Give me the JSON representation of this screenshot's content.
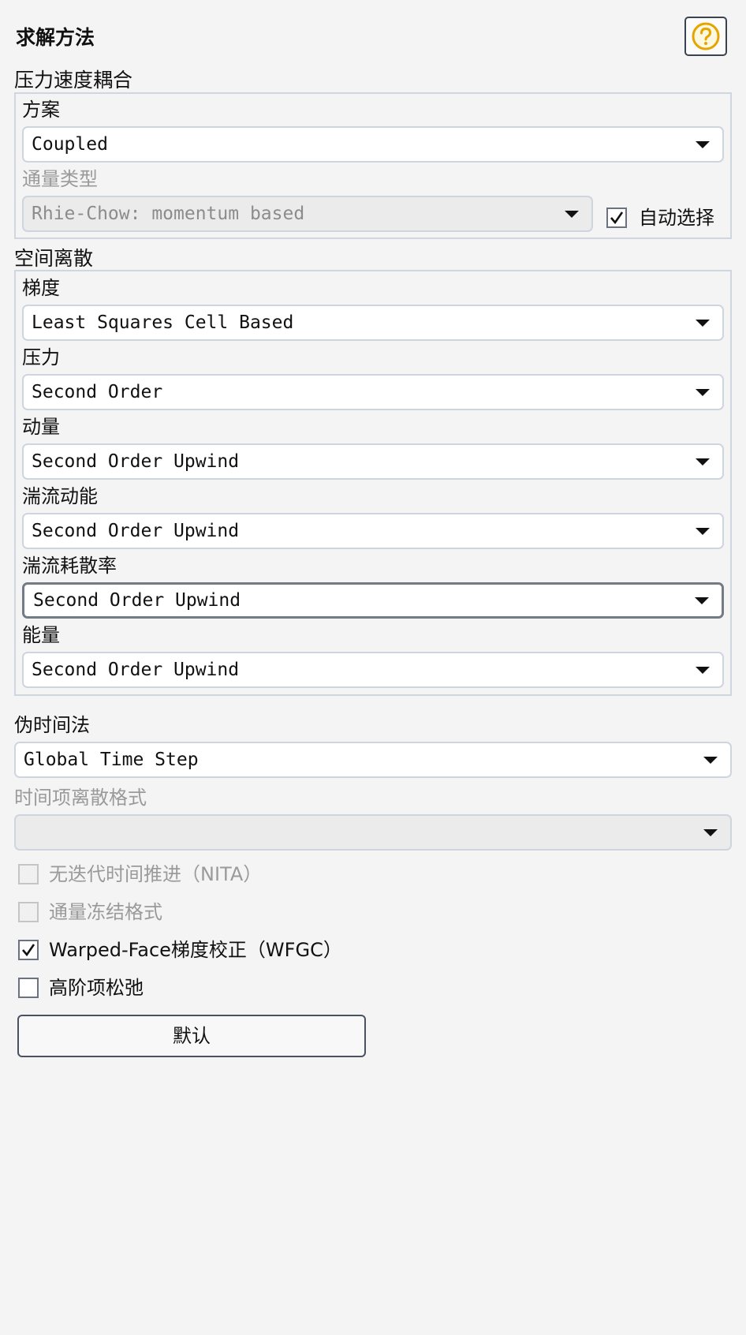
{
  "panel": {
    "title": "求解方法",
    "help_icon": "question-mark-circle-icon"
  },
  "pressure_velocity": {
    "section_title": "压力速度耦合",
    "scheme_label": "方案",
    "scheme_value": "Coupled",
    "flux_type_label": "通量类型",
    "flux_type_value": "Rhie-Chow: momentum based",
    "auto_select_label": "自动选择",
    "auto_select_checked": true
  },
  "spatial": {
    "section_title": "空间离散",
    "gradient_label": "梯度",
    "gradient_value": "Least Squares Cell Based",
    "pressure_label": "压力",
    "pressure_value": "Second Order",
    "momentum_label": "动量",
    "momentum_value": "Second Order Upwind",
    "tke_label": "湍流动能",
    "tke_value": "Second Order Upwind",
    "dissipation_label": "湍流耗散率",
    "dissipation_value": "Second Order Upwind",
    "energy_label": "能量",
    "energy_value": "Second Order Upwind"
  },
  "pseudo_time": {
    "label": "伪时间法",
    "value": "Global Time Step"
  },
  "transient": {
    "label": "时间项离散格式",
    "value": ""
  },
  "options": {
    "nita_label": "无迭代时间推进（NITA）",
    "nita_checked": false,
    "frozen_flux_label": "通量冻结格式",
    "frozen_flux_checked": false,
    "wfgc_label": "Warped-Face梯度校正（WFGC）",
    "wfgc_checked": true,
    "high_order_label": "高阶项松弛",
    "high_order_checked": false
  },
  "default_button": "默认",
  "colors": {
    "accent_help": "#e6a400",
    "border": "#d0d6e0",
    "disabled_text": "#9a9a9a"
  }
}
